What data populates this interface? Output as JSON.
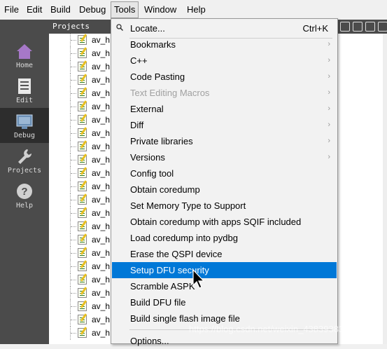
{
  "menubar": {
    "items": [
      {
        "label": "File"
      },
      {
        "label": "Edit"
      },
      {
        "label": "Build"
      },
      {
        "label": "Debug"
      },
      {
        "label": "Tools"
      },
      {
        "label": "Window"
      },
      {
        "label": "Help"
      }
    ],
    "active": "Tools"
  },
  "modes": [
    {
      "label": "Home",
      "icon": "home-icon"
    },
    {
      "label": "Edit",
      "icon": "edit-icon"
    },
    {
      "label": "Debug",
      "icon": "debug-icon"
    },
    {
      "label": "Projects",
      "icon": "wrench-icon"
    },
    {
      "label": "Help",
      "icon": "help-icon"
    }
  ],
  "active_mode": "Debug",
  "projects_header": "Projects",
  "tree_files": [
    "av_h",
    "av_h",
    "av_h",
    "av_h",
    "av_h",
    "av_h",
    "av_h",
    "av_h",
    "av_h",
    "av_h",
    "av_h",
    "av_h",
    "av_h",
    "av_h",
    "av_h",
    "av_h",
    "av_h",
    "av_h",
    "av_h",
    "av_h",
    "av_h",
    "av_h",
    "av_h",
    "av_h",
    "av_h"
  ],
  "tools_menu": {
    "locate": {
      "label": "Locate...",
      "shortcut": "Ctrl+K"
    },
    "items": [
      {
        "label": "Bookmarks",
        "submenu": true
      },
      {
        "label": "C++",
        "submenu": true
      },
      {
        "label": "Code Pasting",
        "submenu": true
      },
      {
        "label": "Text Editing Macros",
        "submenu": true,
        "disabled": true
      },
      {
        "label": "External",
        "submenu": true
      },
      {
        "label": "Diff",
        "submenu": true
      },
      {
        "label": "Private libraries",
        "submenu": true
      },
      {
        "label": "Versions",
        "submenu": true
      },
      {
        "label": "Config tool"
      },
      {
        "label": "Obtain coredump"
      },
      {
        "label": "Set Memory Type to Support"
      },
      {
        "label": "Obtain coredump with apps SQIF included"
      },
      {
        "label": "Load coredump into pydbg"
      },
      {
        "label": "Erase the QSPI device"
      },
      {
        "label": "Setup DFU security",
        "highlighted": true
      },
      {
        "label": "Scramble ASPK"
      },
      {
        "label": "Build DFU file"
      },
      {
        "label": "Build single flash image file"
      }
    ],
    "options": {
      "label": "Options..."
    }
  },
  "watermark": "https://blog.csdn.net/weixin_43839383",
  "colors": {
    "highlight": "#0078d7",
    "modebar": "#4b4b4b"
  }
}
